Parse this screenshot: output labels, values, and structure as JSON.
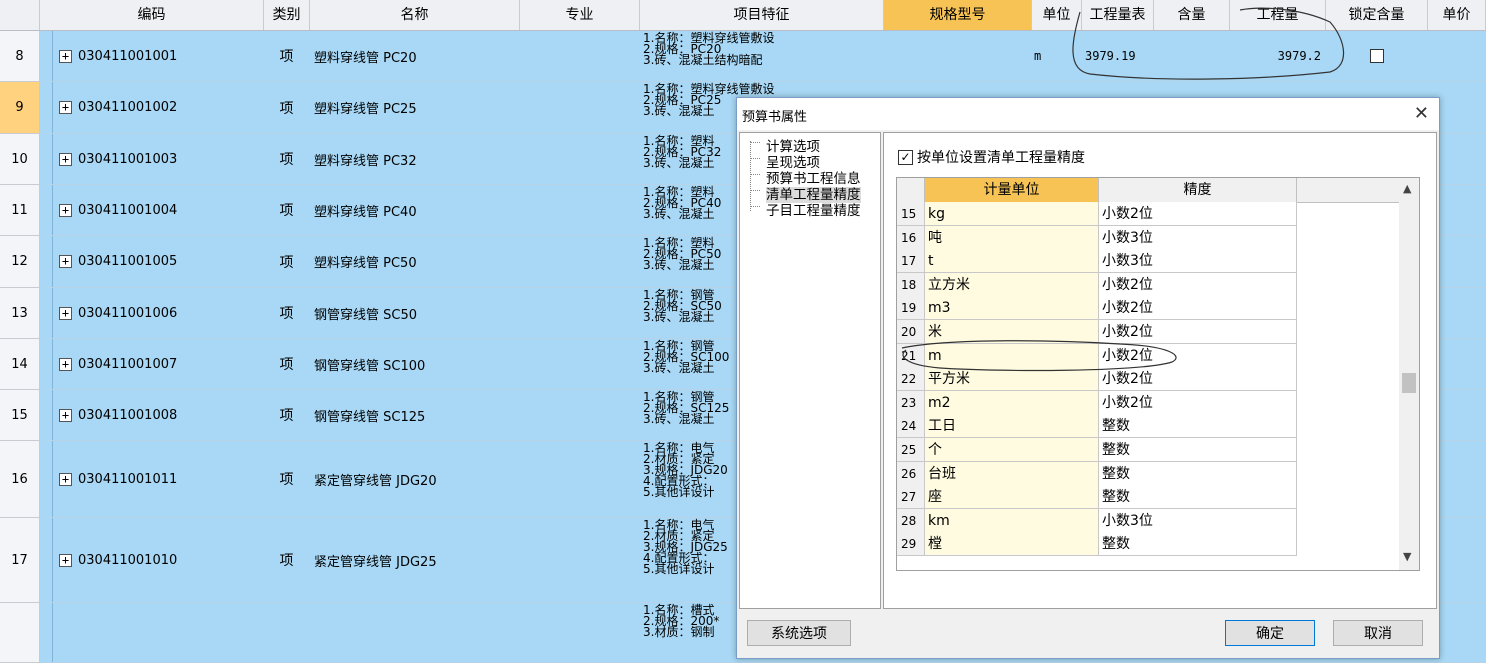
{
  "grid": {
    "columns": [
      "编码",
      "类别",
      "名称",
      "专业",
      "项目特征",
      "规格型号",
      "单位",
      "工程量表",
      "含量",
      "工程量",
      "锁定含量",
      "单价"
    ],
    "highlight_column": "规格型号",
    "rows": [
      {
        "num": "8",
        "code": "030411001001",
        "type": "项",
        "name": "塑料穿线管 PC20",
        "spec": "1.名称：塑料穿线管敷设\n2.规格：PC20\n3.砖、混凝土结构暗配",
        "unit": "m",
        "expr": "3979.19",
        "qty": "3979.2",
        "locked": false
      },
      {
        "num": "9",
        "code": "030411001002",
        "type": "项",
        "name": "塑料穿线管 PC25",
        "spec": "1.名称：塑料穿线管敷设\n2.规格：PC25\n3.砖、混凝土",
        "selected": true
      },
      {
        "num": "10",
        "code": "030411001003",
        "type": "项",
        "name": "塑料穿线管 PC32",
        "spec": "1.名称：塑料\n2.规格：PC32\n3.砖、混凝土"
      },
      {
        "num": "11",
        "code": "030411001004",
        "type": "项",
        "name": "塑料穿线管 PC40",
        "spec": "1.名称：塑料\n2.规格：PC40\n3.砖、混凝土"
      },
      {
        "num": "12",
        "code": "030411001005",
        "type": "项",
        "name": "塑料穿线管 PC50",
        "spec": "1.名称：塑料\n2.规格：PC50\n3.砖、混凝土"
      },
      {
        "num": "13",
        "code": "030411001006",
        "type": "项",
        "name": "钢管穿线管 SC50",
        "spec": "1.名称：钢管\n2.规格：SC50\n3.砖、混凝土"
      },
      {
        "num": "14",
        "code": "030411001007",
        "type": "项",
        "name": "钢管穿线管 SC100",
        "spec": "1.名称：钢管\n2.规格：SC100\n3.砖、混凝土"
      },
      {
        "num": "15",
        "code": "030411001008",
        "type": "项",
        "name": "钢管穿线管 SC125",
        "spec": "1.名称：钢管\n2.规格：SC125\n3.砖、混凝土"
      },
      {
        "num": "16",
        "code": "030411001011",
        "type": "项",
        "name": "紧定管穿线管 JDG20",
        "spec": "1.名称：电气\n2.材质：紧定\n3.规格：JDG20\n4.配置形式：\n5.其他详设计"
      },
      {
        "num": "17",
        "code": "030411001010",
        "type": "项",
        "name": "紧定管穿线管 JDG25",
        "spec": "1.名称：电气\n2.材质：紧定\n3.规格：JDG25\n4.配置形式：\n5.其他详设计"
      },
      {
        "num": "",
        "code": "",
        "type": "",
        "name": "",
        "spec": "1.名称：槽式\n2.规格：200*\n3.材质：钢制"
      }
    ]
  },
  "dialog": {
    "title": "预算书属性",
    "close_icon": "close-icon",
    "tree": [
      "计算选项",
      "呈现选项",
      "预算书工程信息",
      "清单工程量精度",
      "子目工程量精度"
    ],
    "tree_selected": "清单工程量精度",
    "checkbox_label": "按单位设置清单工程量精度",
    "checkbox_checked": true,
    "table_headers": [
      "计量单位",
      "精度"
    ],
    "table_rows": [
      {
        "n": "15",
        "unit": "kg",
        "prec": "小数2位"
      },
      {
        "n": "16",
        "unit": "吨",
        "prec": "小数3位"
      },
      {
        "n": "17",
        "unit": "t",
        "prec": "小数3位"
      },
      {
        "n": "18",
        "unit": "立方米",
        "prec": "小数2位"
      },
      {
        "n": "19",
        "unit": "m3",
        "prec": "小数2位"
      },
      {
        "n": "20",
        "unit": "米",
        "prec": "小数2位"
      },
      {
        "n": "21",
        "unit": "m",
        "prec": "小数2位"
      },
      {
        "n": "22",
        "unit": "平方米",
        "prec": "小数2位"
      },
      {
        "n": "23",
        "unit": "m2",
        "prec": "小数2位"
      },
      {
        "n": "24",
        "unit": "工日",
        "prec": "整数"
      },
      {
        "n": "25",
        "unit": "个",
        "prec": "整数"
      },
      {
        "n": "26",
        "unit": "台班",
        "prec": "整数"
      },
      {
        "n": "27",
        "unit": "座",
        "prec": "整数"
      },
      {
        "n": "28",
        "unit": "km",
        "prec": "小数3位"
      },
      {
        "n": "29",
        "unit": "樘",
        "prec": "整数"
      }
    ],
    "buttons": {
      "system": "系统选项",
      "ok": "确定",
      "cancel": "取消"
    }
  },
  "colors": {
    "row_bg": "#a8d8f5",
    "header_highlight": "#f6c354",
    "selected_row_num": "#ffd27f",
    "unit_cell_bg": "#fffbe0"
  }
}
